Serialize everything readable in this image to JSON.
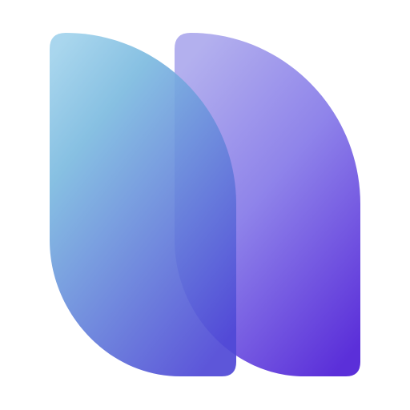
{
  "logo": {
    "icon": "twin-leaf-logo-icon",
    "colors": {
      "left_leaf_top": "#a2d3ec",
      "left_leaf_mid": "#7dbbe0",
      "left_leaf_bottom": "#4f48d6",
      "right_leaf_top": "#b3b0ee",
      "right_leaf_mid": "#8f84ea",
      "right_leaf_bottom": "#5b2fd9",
      "background": "#ffffff"
    }
  }
}
